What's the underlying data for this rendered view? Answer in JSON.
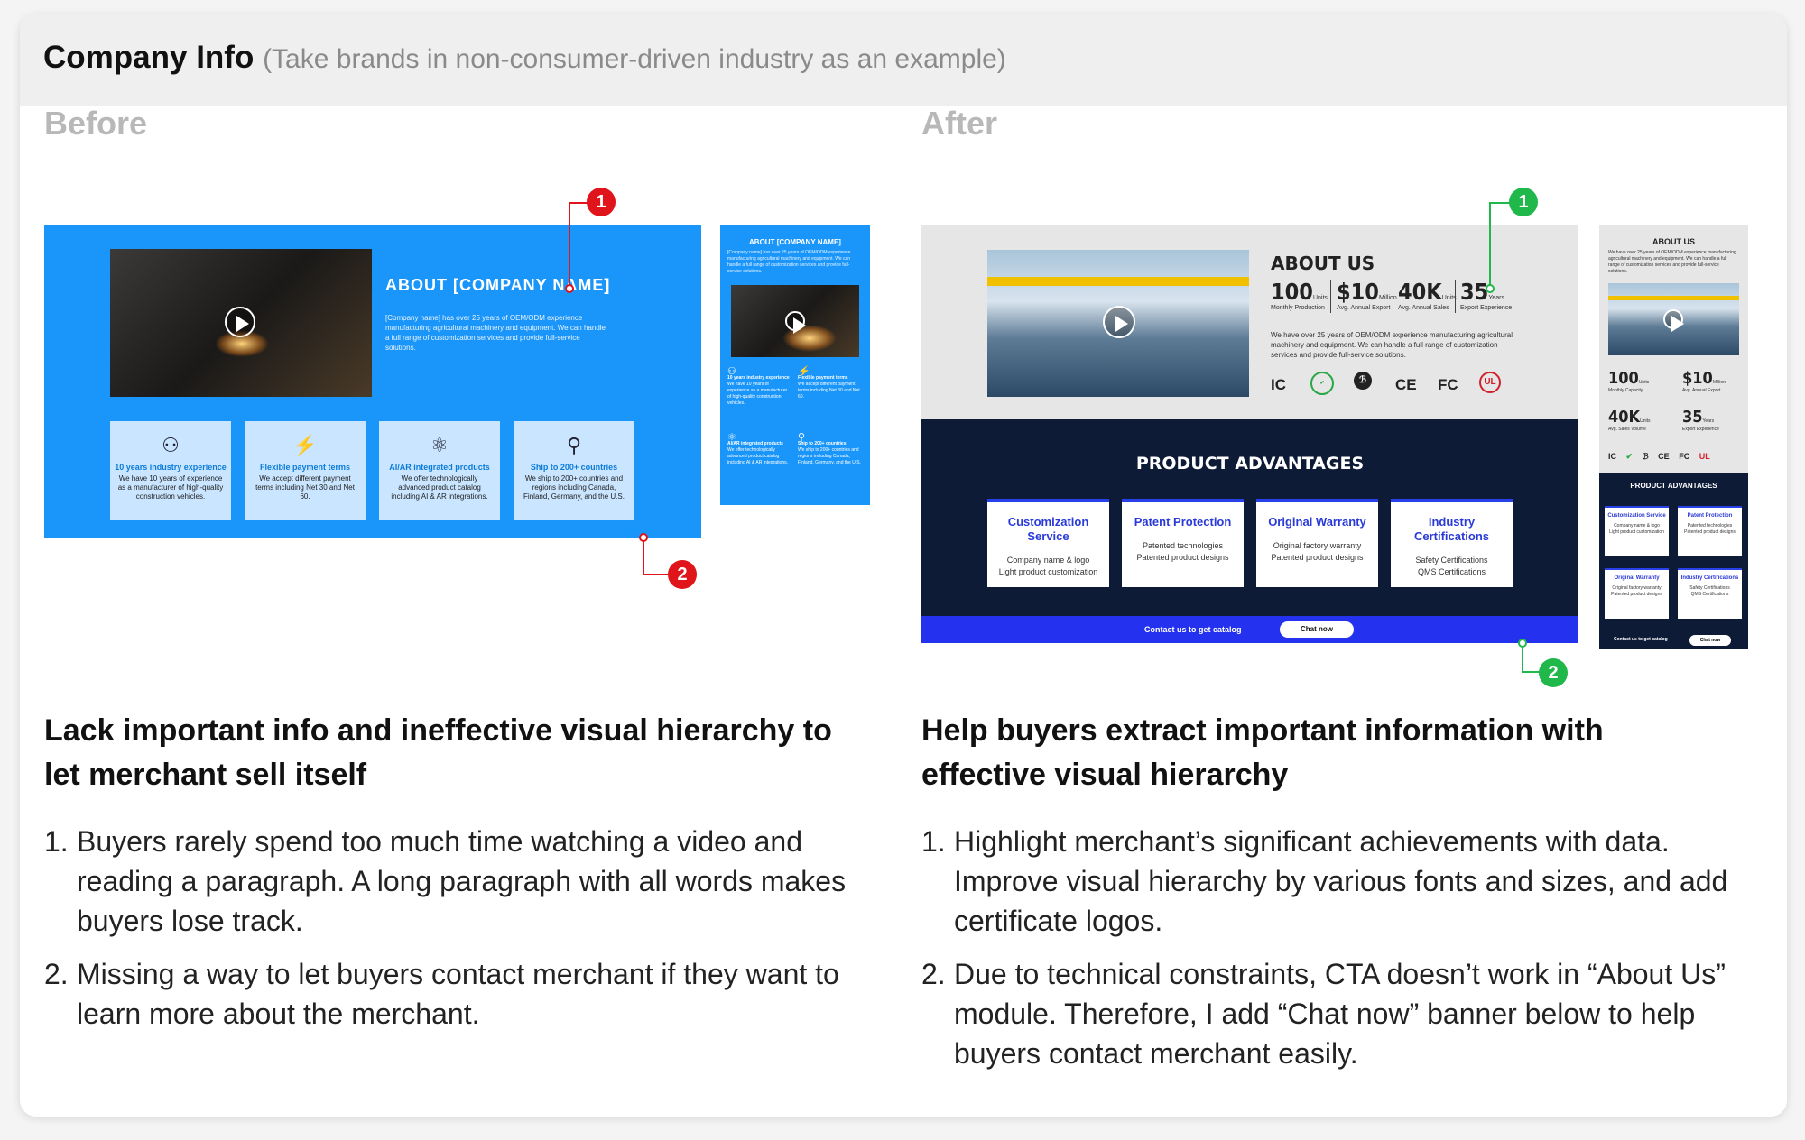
{
  "header": {
    "title": "Company Info",
    "subtitle": "(Take brands in non-consumer-driven industry as an example)"
  },
  "before": {
    "label": "Before",
    "desktop": {
      "about_title": "ABOUT [COMPANY NAME]",
      "about_text": "[Company name] has over 25 years of OEM/ODM experience manufacturing agricultural machinery and equipment. We can handle a full range of customization services and provide full-service solutions.",
      "features": [
        {
          "icon": "users-icon",
          "title": "10 years industry experience",
          "desc": "We have 10 years of experience as a manufacturer of high-quality construction vehicles."
        },
        {
          "icon": "payment-icon",
          "title": "Flexible payment terms",
          "desc": "We accept different payment terms including Net 30 and Net 60."
        },
        {
          "icon": "atom-icon",
          "title": "AI/AR integrated products",
          "desc": "We offer technologically advanced product catalog including AI & AR integrations."
        },
        {
          "icon": "location-icon",
          "title": "Ship to 200+ countries",
          "desc": "We ship to 200+ countries and regions including Canada, Finland, Germany, and the U.S."
        }
      ]
    },
    "mobile": {
      "about_title": "ABOUT [COMPANY NAME]",
      "about_text": "[Company name] has over 25 years of OEM/ODM experience manufacturing agricultural machinery and equipment. We can handle a full range of customization services and provide full-service solutions.",
      "features": [
        {
          "title": "10 years industry experience",
          "desc": "We have 10 years of experience as a manufacturer of high-quality construction vehicles."
        },
        {
          "title": "Flexible payment terms",
          "desc": "We accept different payment terms including Net 30 and Net 60."
        },
        {
          "title": "AI/AR integrated products",
          "desc": "We offer technologically advanced product catalog including AI & AR integrations."
        },
        {
          "title": "Ship to 200+ countries",
          "desc": "We ship to 200+ countries and regions including Canada, Finland, Germany, and the U.S."
        }
      ]
    },
    "marker1": "1",
    "marker2": "2",
    "heading": "Lack important info and ineffective visual hierarchy to let merchant sell itself",
    "points": [
      {
        "n": "1.",
        "text": "Buyers rarely spend too much time watching a video and reading a paragraph. A long paragraph with all words makes buyers lose track."
      },
      {
        "n": "2.",
        "text": "Missing a way to let buyers contact merchant if they want to learn more about the merchant."
      }
    ]
  },
  "after": {
    "label": "After",
    "desktop": {
      "about_title": "ABOUT US",
      "stats": [
        {
          "value": "100",
          "unit": "Units",
          "label": "Monthly Production"
        },
        {
          "value": "$10",
          "unit": "Million",
          "label": "Avg. Annual Export"
        },
        {
          "value": "40K",
          "unit": "Units",
          "label": "Avg. Annual Sales"
        },
        {
          "value": "35",
          "unit": "Years",
          "label": "Export Experience"
        }
      ],
      "about_text": "We have over 25 years of OEM/ODM experience manufacturing agricultural machinery and equipment. We can handle a full range of customization services and provide full-service solutions.",
      "certs": [
        "IC",
        "RoHS",
        "Bluetooth",
        "CE",
        "FC",
        "UL"
      ],
      "advantages_title": "PRODUCT ADVANTAGES",
      "advantages": [
        {
          "title": "Customization Service",
          "desc1": "Company name & logo",
          "desc2": "Light product customization"
        },
        {
          "title": "Patent Protection",
          "desc1": "Patented technologies",
          "desc2": "Patented product designs"
        },
        {
          "title": "Original Warranty",
          "desc1": "Original factory warranty",
          "desc2": "Patented product designs"
        },
        {
          "title": "Industry Certifications",
          "desc1": "Safety Certifications",
          "desc2": "QMS Certifications"
        }
      ],
      "cta_text": "Contact us to get catalog",
      "cta_button": "Chat now"
    },
    "mobile": {
      "about_title": "ABOUT US",
      "about_text": "We have over 25 years of OEM/ODM experience manufacturing agricultural machinery and equipment. We can handle a full range of customization services and provide full-service solutions.",
      "stats": [
        {
          "value": "100",
          "unit": "Units",
          "label": "Monthly Capacity"
        },
        {
          "value": "$10",
          "unit": "Million",
          "label": "Avg. Annual Export"
        },
        {
          "value": "40K",
          "unit": "Units",
          "label": "Avg. Sales Volume"
        },
        {
          "value": "35",
          "unit": "Years",
          "label": "Export Experience"
        }
      ],
      "advantages_title": "PRODUCT ADVANTAGES",
      "advantages": [
        {
          "title": "Customization Service",
          "desc1": "Company name & logo",
          "desc2": "Light product customization"
        },
        {
          "title": "Patent Protection",
          "desc1": "Patented technologies",
          "desc2": "Patented product designs"
        },
        {
          "title": "Original Warranty",
          "desc1": "Original factory warranty",
          "desc2": "Patented product designs"
        },
        {
          "title": "Industry Certifications",
          "desc1": "Safety Certifications",
          "desc2": "QMS Certifications"
        }
      ],
      "cta_text": "Contact us to get catalog",
      "cta_button": "Chat now"
    },
    "marker1": "1",
    "marker2": "2",
    "heading": "Help buyers extract important information with effective visual hierarchy",
    "points": [
      {
        "n": "1.",
        "text": "Highlight merchant’s significant achievements with data. Improve visual hierarchy by various fonts and sizes, and add certificate logos."
      },
      {
        "n": "2.",
        "text": "Due to technical constraints, CTA doesn’t work in “About Us” module. Therefore, I add “Chat now” banner below to help buyers contact merchant easily."
      }
    ]
  },
  "colors": {
    "before_blue": "#1a96fb",
    "after_navy": "#0d1b36",
    "cta_blue": "#2432f0",
    "marker_red": "#e0141b",
    "marker_green": "#20b84a"
  }
}
